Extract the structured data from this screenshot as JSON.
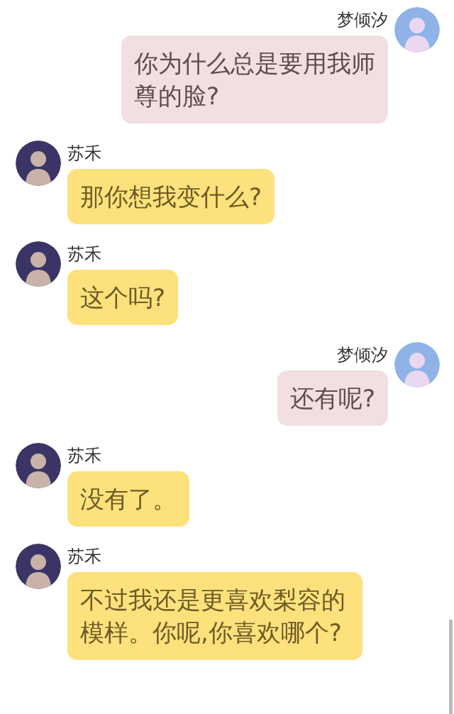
{
  "messages": [
    {
      "kind": "sent",
      "sender": "梦倾汐",
      "text": "你为什么总是要用我师尊的脸?"
    },
    {
      "kind": "received",
      "sender": "苏禾",
      "text": "那你想我变什么?"
    },
    {
      "kind": "received",
      "sender": "苏禾",
      "text": "这个吗?"
    },
    {
      "kind": "sent",
      "sender": "梦倾汐",
      "text": "还有呢?"
    },
    {
      "kind": "received",
      "sender": "苏禾",
      "text": "没有了。"
    },
    {
      "kind": "received",
      "sender": "苏禾",
      "text": "不过我还是更喜欢梨容的模样。你呢,你喜欢哪个?"
    }
  ]
}
